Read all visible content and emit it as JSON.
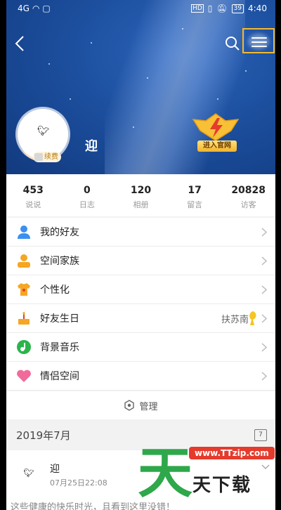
{
  "status_bar": {
    "signal": "4G",
    "battery": "39",
    "time": "4:40"
  },
  "profile": {
    "username": "迎",
    "renew_badge": "续费",
    "official_label": "进入官网"
  },
  "stats": [
    {
      "value": "453",
      "label": "说说"
    },
    {
      "value": "0",
      "label": "日志"
    },
    {
      "value": "120",
      "label": "相册"
    },
    {
      "value": "17",
      "label": "留言"
    },
    {
      "value": "20828",
      "label": "访客"
    }
  ],
  "menu": [
    {
      "label": "我的好友",
      "icon": "friends-icon",
      "color": "#3b8ff0"
    },
    {
      "label": "空间家族",
      "icon": "family-icon",
      "color": "#f5a623"
    },
    {
      "label": "个性化",
      "icon": "tshirt-icon",
      "color": "#f5a623"
    },
    {
      "label": "好友生日",
      "icon": "cake-icon",
      "color": "#f5a623",
      "right": "扶苏南"
    },
    {
      "label": "背景音乐",
      "icon": "music-icon",
      "color": "#2bb44a"
    },
    {
      "label": "情侣空间",
      "icon": "heart-icon",
      "color": "#f06b9a"
    }
  ],
  "manage_label": "管理",
  "date_header": "2019年7月",
  "calendar_day": "7",
  "feed": {
    "name": "迎",
    "time": "07月25日22:08",
    "text": "这些健康的快乐时光，且看到这里没错！"
  },
  "watermark": {
    "big": "天",
    "url": "www.TTzip.com",
    "brand": "天下载"
  },
  "colors": {
    "accent": "#f3b92a",
    "header_blue": "#1c4f9e"
  }
}
